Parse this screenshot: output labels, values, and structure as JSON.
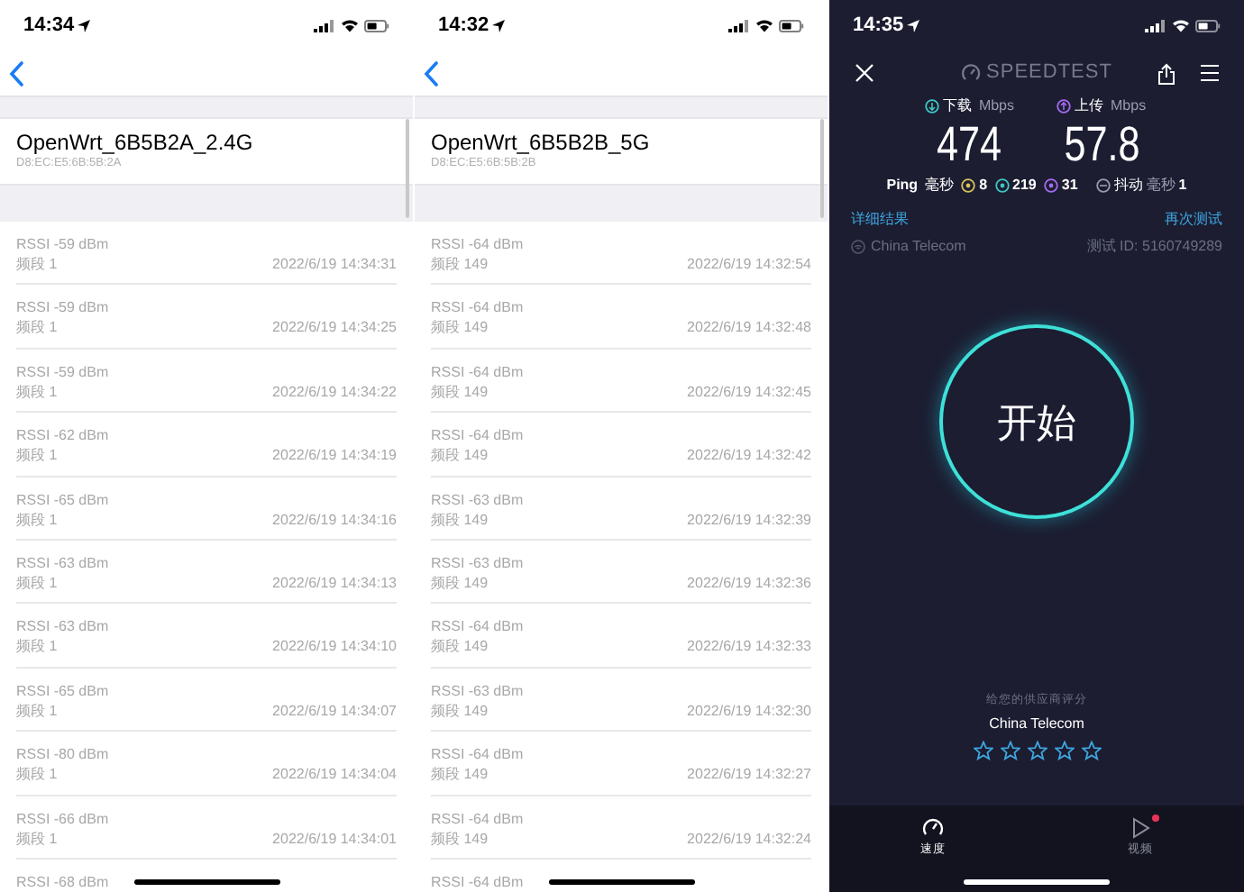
{
  "screens": [
    {
      "kind": "list",
      "time": "14:34",
      "network": {
        "name": "OpenWrt_6B5B2A_2.4G",
        "mac": "D8:EC:E5:6B:5B:2A"
      },
      "rows": [
        {
          "rssi": "RSSI -59 dBm",
          "band": "频段 1",
          "time": "2022/6/19 14:34:31"
        },
        {
          "rssi": "RSSI -59 dBm",
          "band": "频段 1",
          "time": "2022/6/19 14:34:25"
        },
        {
          "rssi": "RSSI -59 dBm",
          "band": "频段 1",
          "time": "2022/6/19 14:34:22"
        },
        {
          "rssi": "RSSI -62 dBm",
          "band": "频段 1",
          "time": "2022/6/19 14:34:19"
        },
        {
          "rssi": "RSSI -65 dBm",
          "band": "频段 1",
          "time": "2022/6/19 14:34:16"
        },
        {
          "rssi": "RSSI -63 dBm",
          "band": "频段 1",
          "time": "2022/6/19 14:34:13"
        },
        {
          "rssi": "RSSI -63 dBm",
          "band": "频段 1",
          "time": "2022/6/19 14:34:10"
        },
        {
          "rssi": "RSSI -65 dBm",
          "band": "频段 1",
          "time": "2022/6/19 14:34:07"
        },
        {
          "rssi": "RSSI -80 dBm",
          "band": "频段 1",
          "time": "2022/6/19 14:34:04"
        },
        {
          "rssi": "RSSI -66 dBm",
          "band": "频段 1",
          "time": "2022/6/19 14:34:01"
        },
        {
          "rssi": "RSSI -68 dBm"
        }
      ]
    },
    {
      "kind": "list",
      "time": "14:32",
      "network": {
        "name": "OpenWrt_6B5B2B_5G",
        "mac": "D8:EC:E5:6B:5B:2B"
      },
      "rows": [
        {
          "rssi": "RSSI -64 dBm",
          "band": "频段 149",
          "time": "2022/6/19 14:32:54"
        },
        {
          "rssi": "RSSI -64 dBm",
          "band": "频段 149",
          "time": "2022/6/19 14:32:48"
        },
        {
          "rssi": "RSSI -64 dBm",
          "band": "频段 149",
          "time": "2022/6/19 14:32:45"
        },
        {
          "rssi": "RSSI -64 dBm",
          "band": "频段 149",
          "time": "2022/6/19 14:32:42"
        },
        {
          "rssi": "RSSI -63 dBm",
          "band": "频段 149",
          "time": "2022/6/19 14:32:39"
        },
        {
          "rssi": "RSSI -63 dBm",
          "band": "频段 149",
          "time": "2022/6/19 14:32:36"
        },
        {
          "rssi": "RSSI -64 dBm",
          "band": "频段 149",
          "time": "2022/6/19 14:32:33"
        },
        {
          "rssi": "RSSI -63 dBm",
          "band": "频段 149",
          "time": "2022/6/19 14:32:30"
        },
        {
          "rssi": "RSSI -64 dBm",
          "band": "频段 149",
          "time": "2022/6/19 14:32:27"
        },
        {
          "rssi": "RSSI -64 dBm",
          "band": "频段 149",
          "time": "2022/6/19 14:32:24"
        },
        {
          "rssi": "RSSI -64 dBm"
        }
      ]
    },
    {
      "kind": "speedtest",
      "time": "14:35",
      "logo": "SPEEDTEST",
      "download": {
        "label": "下载",
        "unit": "Mbps",
        "value": "474"
      },
      "upload": {
        "label": "上传",
        "unit": "Mbps",
        "value": "57.8"
      },
      "ping": {
        "label": "Ping",
        "unit": "毫秒",
        "idle": "8",
        "down": "219",
        "up": "31"
      },
      "jitter": {
        "label": "抖动",
        "unit": "毫秒",
        "value": "1"
      },
      "details_link": "详细结果",
      "retest_link": "再次测试",
      "isp": "China Telecom",
      "test_id": "测试 ID: 5160749289",
      "start": "开始",
      "rating": {
        "prompt": "给您的供应商评分",
        "provider": "China Telecom",
        "stars": 0
      },
      "tabs": [
        {
          "label": "速度",
          "selected": true,
          "badge": false
        },
        {
          "label": "视频",
          "selected": false,
          "badge": true
        }
      ]
    }
  ]
}
